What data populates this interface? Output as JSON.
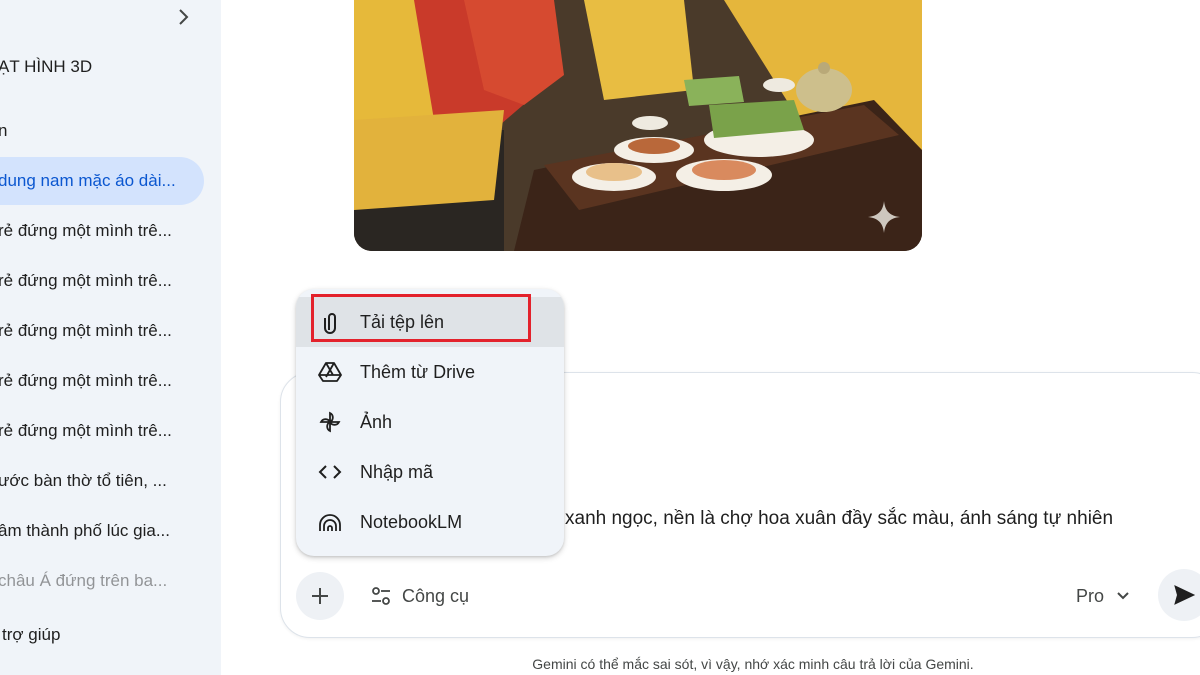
{
  "sidebar": {
    "gem_title": "ẠT HÌNH 3D",
    "section_title": "n",
    "chats": [
      "dung nam mặc áo dài...",
      "rẻ đứng một mình trê...",
      "rẻ đứng một mình trê...",
      "rẻ đứng một mình trê...",
      "rẻ đứng một mình trê...",
      "rẻ đứng một mình trê...",
      "ước bàn thờ tổ tiên, ...",
      "âm thành phố lúc gia...",
      "châu Á đứng trên ba..."
    ],
    "help_label": "trợ giúp"
  },
  "menu": {
    "items": [
      {
        "label": "Tải tệp lên",
        "icon": "paperclip-icon"
      },
      {
        "label": "Thêm từ Drive",
        "icon": "drive-icon"
      },
      {
        "label": "Ảnh",
        "icon": "pinwheel-icon"
      },
      {
        "label": "Nhập mã",
        "icon": "code-icon"
      },
      {
        "label": "NotebookLM",
        "icon": "notebooklm-icon"
      }
    ]
  },
  "prompt": {
    "text": "xanh ngọc, nền là chợ hoa xuân đầy sắc màu, ánh sáng tự nhiên",
    "tools_label": "Công cụ",
    "model_label": "Pro"
  },
  "disclaimer": "Gemini có thể mắc sai sót, vì vậy, nhớ xác minh câu trả lời của Gemini.",
  "colors": {
    "sidebar_bg": "#f0f4f9",
    "active_chat_bg": "#d3e3fd",
    "active_chat_text": "#0b57d0",
    "highlight_border": "#e3222c"
  }
}
